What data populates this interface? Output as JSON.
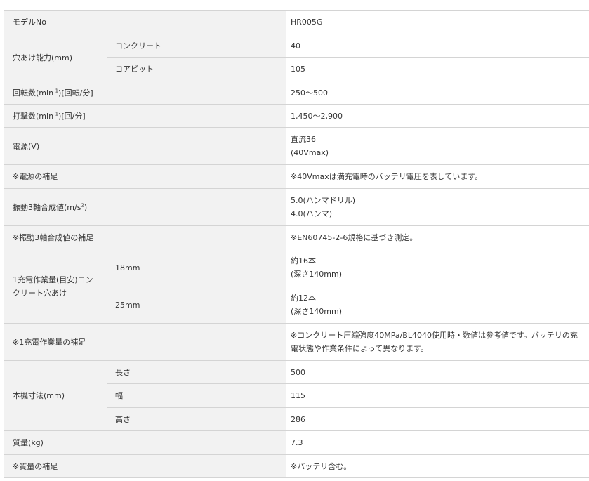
{
  "spec_table": {
    "model": {
      "label": "モデルNo",
      "value": "HR005G"
    },
    "drill_capacity": {
      "label": "穴あけ能力(mm)",
      "rows": [
        {
          "sub": "コンクリート",
          "value": "40"
        },
        {
          "sub": "コアビット",
          "value": "105"
        }
      ]
    },
    "rpm": {
      "label_prefix": "回転数(min",
      "label_sup": "-1",
      "label_suffix": ")[回転/分]",
      "value": "250〜500"
    },
    "bpm": {
      "label_prefix": "打撃数(min",
      "label_sup": "-1",
      "label_suffix": ")[回/分]",
      "value": "1,450〜2,900"
    },
    "power": {
      "label": "電源(V)",
      "value_line1": "直流36",
      "value_line2": "(40Vmax)"
    },
    "power_note": {
      "label": "※電源の補足",
      "value": "※40Vmaxは満充電時のバッテリ電圧を表しています。"
    },
    "vibration": {
      "label_prefix": "振動3軸合成値(m/s",
      "label_sup": "2",
      "label_suffix": ")",
      "value_line1": "5.0(ハンマドリル)",
      "value_line2": "4.0(ハンマ)"
    },
    "vibration_note": {
      "label": "※振動3軸合成値の補足",
      "value": "※EN60745-2-6規格に基づき測定。"
    },
    "work_per_charge": {
      "label_line1": "1充電作業量(目安)コン",
      "label_line2": "クリート穴あけ",
      "rows": [
        {
          "sub": "18mm",
          "value_line1": "約16本",
          "value_line2": "(深さ140mm)"
        },
        {
          "sub": "25mm",
          "value_line1": "約12本",
          "value_line2": "(深さ140mm)"
        }
      ]
    },
    "work_note": {
      "label": "※1充電作業量の補足",
      "value_line1": "※コンクリート圧縮強度40MPa/BL4040使用時・数値は参考値です。バッテリの充",
      "value_line2": "電状態や作業条件によって異なります。"
    },
    "dimensions": {
      "label": "本機寸法(mm)",
      "rows": [
        {
          "sub": "長さ",
          "value": "500"
        },
        {
          "sub": "幅",
          "value": "115"
        },
        {
          "sub": "高さ",
          "value": "286"
        }
      ]
    },
    "weight": {
      "label": "質量(kg)",
      "value": "7.3"
    },
    "weight_note": {
      "label": "※質量の補足",
      "value": "※バッテリ含む。"
    }
  }
}
